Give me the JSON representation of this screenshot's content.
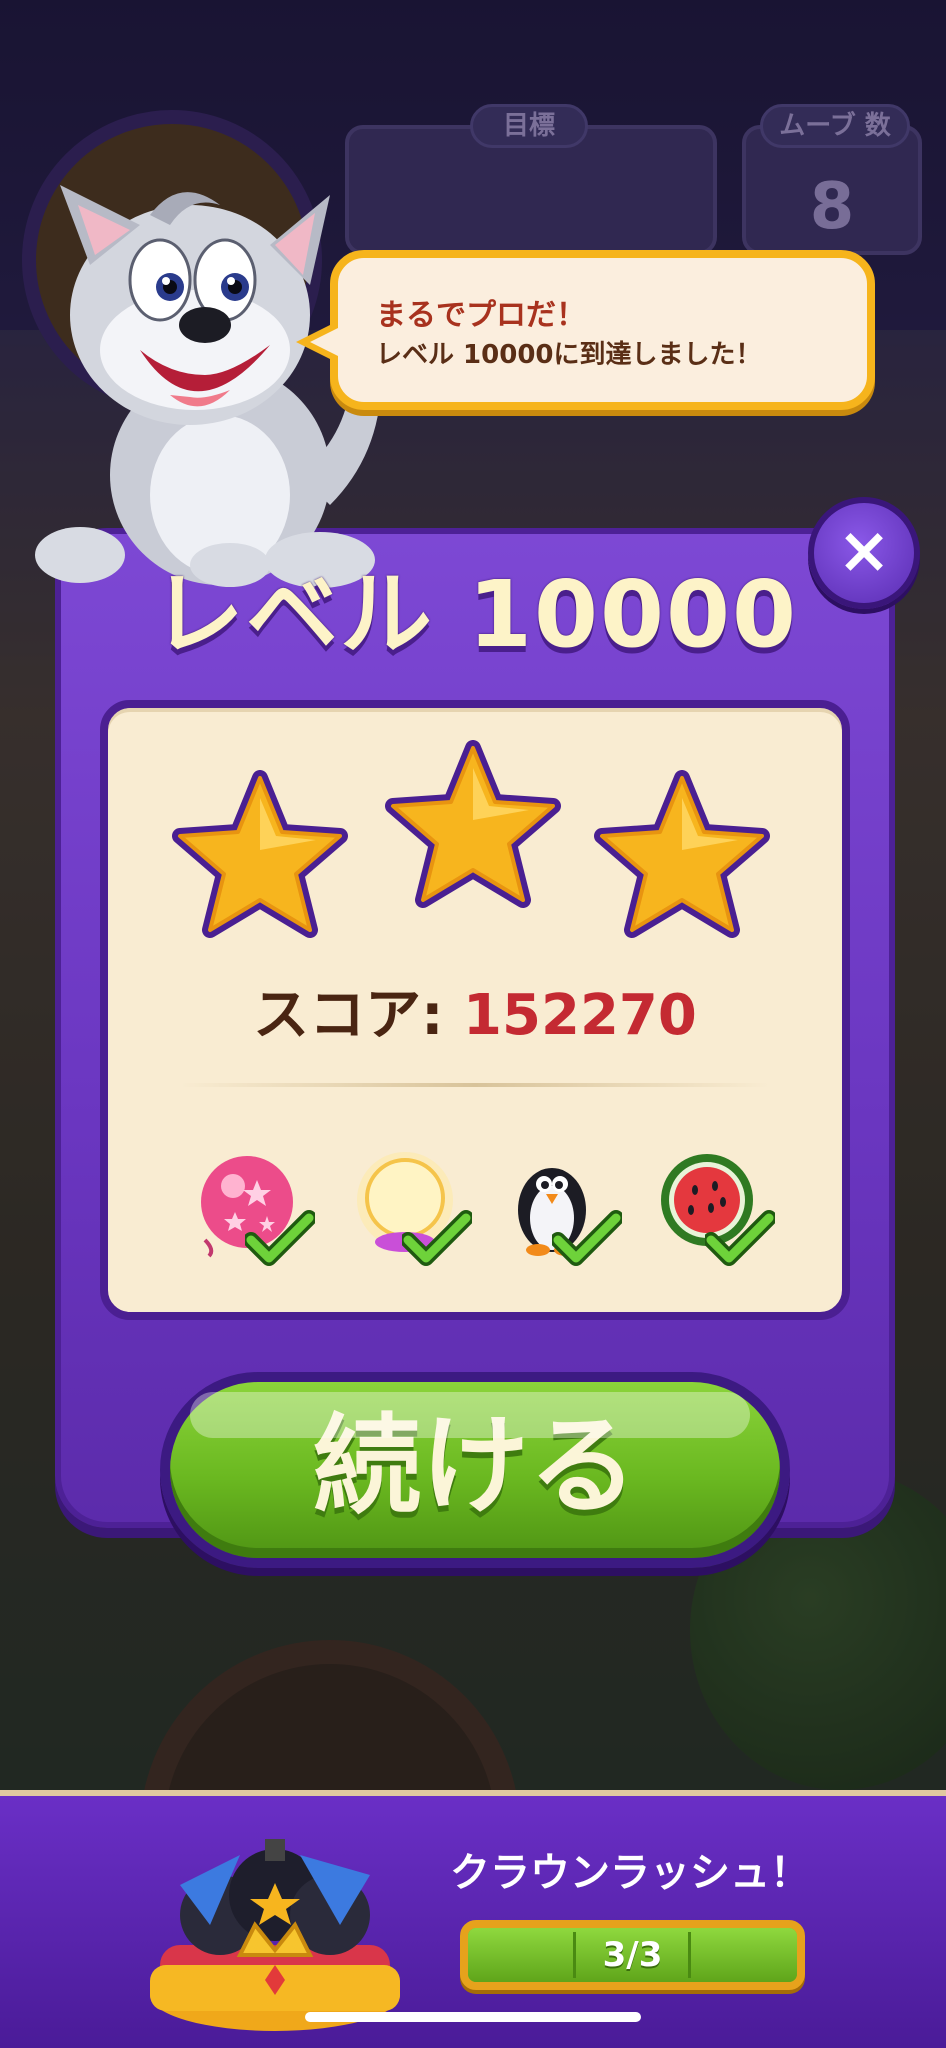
{
  "background": {
    "goal_tab_label": "目標",
    "moves_tab_label": "ムーブ 数",
    "moves_value": "8"
  },
  "speech": {
    "line1": "まるでプロだ！",
    "line2": "レベル 10000に到達しました！"
  },
  "dialog": {
    "title": "レベル 10000",
    "close_glyph": "×",
    "stars_earned": 3,
    "stars_total": 3,
    "score_label": "スコア: ",
    "score_value": "152270",
    "goals": [
      {
        "name": "pink-balloon",
        "completed": true
      },
      {
        "name": "glowing-orb",
        "completed": true
      },
      {
        "name": "penguin",
        "completed": true
      },
      {
        "name": "watermelon",
        "completed": true
      }
    ],
    "continue_label": "続ける"
  },
  "crown_rush": {
    "title": "クラウンラッシュ！",
    "progress_text": "3/3",
    "progress_current": 3,
    "progress_total": 3
  },
  "colors": {
    "dialog_purple": "#6a36c0",
    "score_red": "#c42a32",
    "button_green": "#6ab820",
    "star_gold": "#f7b51e"
  }
}
